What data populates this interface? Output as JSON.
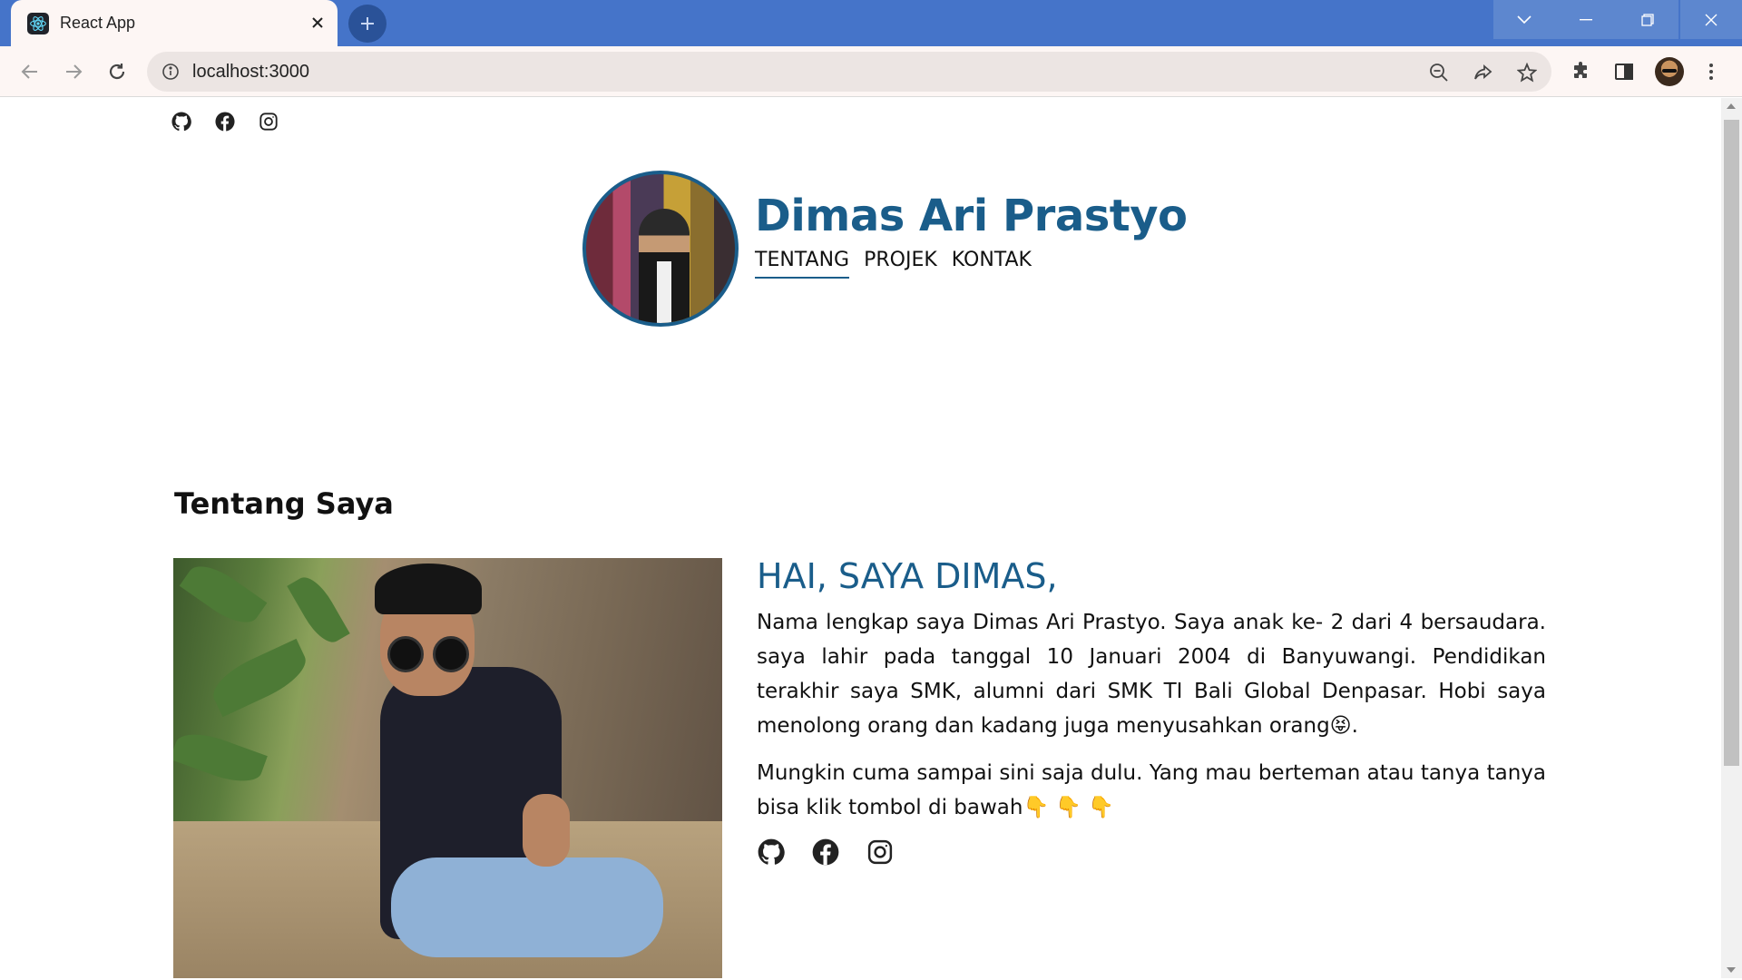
{
  "browser": {
    "tab_title": "React App",
    "url": "localhost:3000",
    "colors": {
      "tabstrip": "#4574c9",
      "toolbar": "#fdf6f4"
    },
    "icons": [
      "react-icon",
      "close-icon",
      "plus-icon",
      "back-icon",
      "forward-icon",
      "reload-icon",
      "info-icon",
      "zoom-out-icon",
      "share-icon",
      "star-icon",
      "extensions-icon",
      "side-panel-icon",
      "menu-icon"
    ]
  },
  "site": {
    "name": "Dimas Ari Prastyo",
    "nav": [
      {
        "label": "TENTANG",
        "active": true
      },
      {
        "label": "PROJEK",
        "active": false
      },
      {
        "label": "KONTAK",
        "active": false
      }
    ],
    "social_icons": [
      "github-icon",
      "facebook-icon",
      "instagram-icon"
    ],
    "accent_color": "#1a5d8a"
  },
  "about": {
    "section_title": "Tentang Saya",
    "greeting": "HAI, SAYA DIMAS,",
    "paragraph1": "Nama lengkap saya Dimas Ari Prastyo. Saya anak ke- 2 dari 4 bersaudara. saya lahir pada tanggal 10 Januari 2004 di Banyuwangi. Pendidikan terakhir saya SMK, alumni dari SMK TI Bali Global Denpasar. Hobi saya menolong orang dan kadang juga menyusahkan orang😝.",
    "paragraph2": "Mungkin cuma sampai sini saja dulu. Yang mau berteman atau tanya tanya bisa klik tombol di bawah👇 👇 👇"
  }
}
